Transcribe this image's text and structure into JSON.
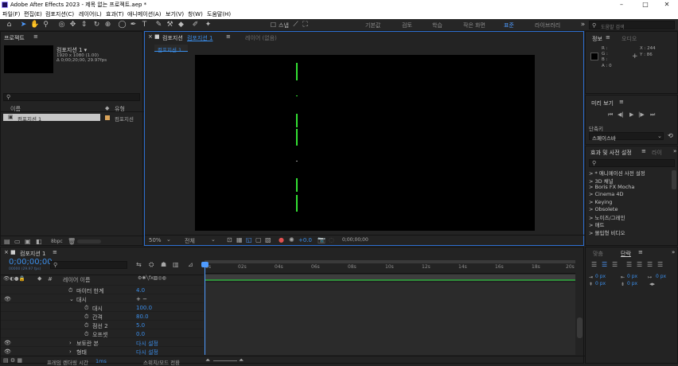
{
  "window": {
    "title": "Adobe After Effects 2023 - 제목 없는 프로젝트.aep *"
  },
  "menu": [
    "파일(F)",
    "편집(E)",
    "컴포지션(C)",
    "레이어(L)",
    "효과(T)",
    "애니메이션(A)",
    "보기(V)",
    "창(W)",
    "도움말(H)"
  ],
  "toolbar": {
    "snap_label": "스냅",
    "workspaces": [
      "기본값",
      "검토",
      "학습",
      "작은 화면",
      "표준",
      "라이브러리"
    ],
    "active_workspace": "표준",
    "search_placeholder": "도움말 검색"
  },
  "project": {
    "tab": "프로젝트",
    "comp_name": "컴포지션 1 ▾",
    "comp_size": "1920 x 1080 (1.00)",
    "comp_duration": "Δ 0;00;20;00, 29.97fps",
    "col_name": "이름",
    "col_type": "유형",
    "items": [
      {
        "name": "컴포지션 1",
        "type": "컴포지션"
      }
    ],
    "bpc": "8bpc"
  },
  "viewer": {
    "tab_comp": "컴포지션",
    "tab_comp_name": "컴포지션 1",
    "tab_layer": "레이어 (없음)",
    "subtab": "컴포지션 1",
    "zoom": "50%",
    "resolution": "전체",
    "exposure": "+0.0",
    "timecode": "0;00;00;00"
  },
  "info": {
    "tab": "정보",
    "tab2": "오디오",
    "r": "R :",
    "g": "G :",
    "b": "B :",
    "a": "A : 0",
    "x": "X : 244",
    "y": "Y : 86"
  },
  "preview": {
    "tab": "미리 보기",
    "shortcut_label": "단축키",
    "shortcut_value": "스페이스바"
  },
  "effects": {
    "tab": "효과 및 사전 설정",
    "tab2": "라이",
    "items": [
      "> * 애니메이션 사전 설정",
      "> 3D 채널",
      "> Boris FX Mocha",
      "> Cinema 4D",
      "> Keying",
      "> Obsolete",
      "> 노이즈/그레인",
      "> 매트",
      "> 몰입형 비디오"
    ]
  },
  "paragraph": {
    "tab1": "맞춤",
    "tab2": "단락",
    "indent": [
      "0 px",
      "0 px",
      "0 px",
      "0 px",
      "0 px"
    ]
  },
  "timeline": {
    "tab": "컴포지션 1",
    "timecode": "0;00;00;00",
    "frame_info": "00000 (29.97 fps)",
    "col_layer": "레이어 이름",
    "col_switch": "부모 및 링크",
    "rows": [
      {
        "label": "마이터 한계",
        "value": "4.0",
        "indent": 95
      },
      {
        "label": "대시",
        "value": "",
        "indent": 95,
        "extra": "+ −"
      },
      {
        "label": "대시",
        "value": "100.0",
        "indent": 115
      },
      {
        "label": "간격",
        "value": "80.0",
        "indent": 115
      },
      {
        "label": "점선 2",
        "value": "5.0",
        "indent": 115
      },
      {
        "label": "오프셋",
        "value": "0.0",
        "indent": 115
      },
      {
        "label": "보토란 본",
        "value": "다시 설정",
        "indent": 95
      },
      {
        "label": "형태",
        "value": "다시 설정",
        "indent": 95
      }
    ],
    "ruler": [
      "0s",
      "02s",
      "04s",
      "06s",
      "08s",
      "10s",
      "12s",
      "14s",
      "16s",
      "18s",
      "20s"
    ],
    "footer_left": "프레임 렌더링 시간",
    "footer_time": "1ms",
    "footer_mid": "스위치/모드 전환"
  }
}
